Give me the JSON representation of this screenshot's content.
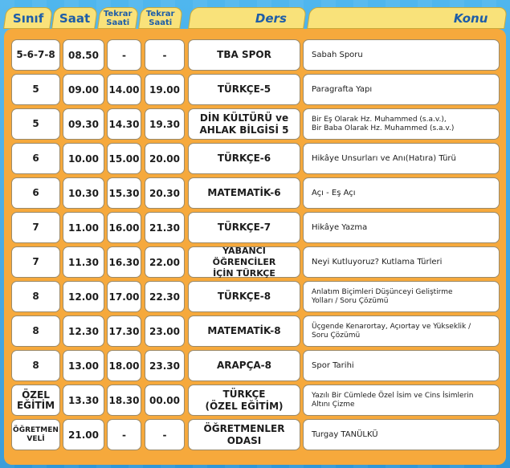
{
  "header": {
    "sinif": "Sınıf",
    "saat": "Saat",
    "tekrar1": "Tekrar\nSaati",
    "tekrar2": "Tekrar\nSaati",
    "ders": "Ders",
    "konu": "Konu"
  },
  "rows": [
    {
      "sinif": "5-6-7-8",
      "saat": "08.50",
      "tekrar1": "-",
      "tekrar2": "-",
      "ders": "TBA SPOR",
      "konu": "Sabah Sporu"
    },
    {
      "sinif": "5",
      "saat": "09.00",
      "tekrar1": "14.00",
      "tekrar2": "19.00",
      "ders": "TÜRKÇE-5",
      "konu": "Paragrafta Yapı"
    },
    {
      "sinif": "5",
      "saat": "09.30",
      "tekrar1": "14.30",
      "tekrar2": "19.30",
      "ders": "DİN KÜLTÜRÜ ve\nAHLAK BİLGİSİ 5",
      "konu": "Bir Eş Olarak Hz. Muhammed (s.a.v.),\nBir Baba Olarak Hz. Muhammed (s.a.v.)"
    },
    {
      "sinif": "6",
      "saat": "10.00",
      "tekrar1": "15.00",
      "tekrar2": "20.00",
      "ders": "TÜRKÇE-6",
      "konu": "Hikâye Unsurları ve Anı(Hatıra) Türü"
    },
    {
      "sinif": "6",
      "saat": "10.30",
      "tekrar1": "15.30",
      "tekrar2": "20.30",
      "ders": "MATEMATİK-6",
      "konu": "Açı - Eş Açı"
    },
    {
      "sinif": "7",
      "saat": "11.00",
      "tekrar1": "16.00",
      "tekrar2": "21.30",
      "ders": "TÜRKÇE-7",
      "konu": "Hikâye Yazma"
    },
    {
      "sinif": "7",
      "saat": "11.30",
      "tekrar1": "16.30",
      "tekrar2": "22.00",
      "ders": "YABANCI ÖĞRENCİLER\nİÇİN TÜRKÇE",
      "konu": "Neyi Kutluyoruz? Kutlama Türleri"
    },
    {
      "sinif": "8",
      "saat": "12.00",
      "tekrar1": "17.00",
      "tekrar2": "22.30",
      "ders": "TÜRKÇE-8",
      "konu": "Anlatım Biçimleri Düşünceyi Geliştirme\nYolları / Soru Çözümü"
    },
    {
      "sinif": "8",
      "saat": "12.30",
      "tekrar1": "17.30",
      "tekrar2": "23.00",
      "ders": "MATEMATİK-8",
      "konu": "Üçgende Kenarortay, Açıortay ve Yükseklik /\nSoru Çözümü"
    },
    {
      "sinif": "8",
      "saat": "13.00",
      "tekrar1": "18.00",
      "tekrar2": "23.30",
      "ders": "ARAPÇA-8",
      "konu": "Spor Tarihi"
    },
    {
      "sinif": "ÖZEL\nEĞİTİM",
      "saat": "13.30",
      "tekrar1": "18.30",
      "tekrar2": "00.00",
      "ders": "TÜRKÇE\n(ÖZEL EĞİTİM)",
      "konu": "Yazılı Bir Cümlede Özel İsim ve Cins İsimlerin\nAltını Çizme"
    },
    {
      "sinif": "ÖĞRETMEN\nVELİ",
      "saat": "21.00",
      "tekrar1": "-",
      "tekrar2": "-",
      "ders": "ÖĞRETMENLER\nODASI",
      "konu": "Turgay TANÜLKÜ"
    }
  ]
}
